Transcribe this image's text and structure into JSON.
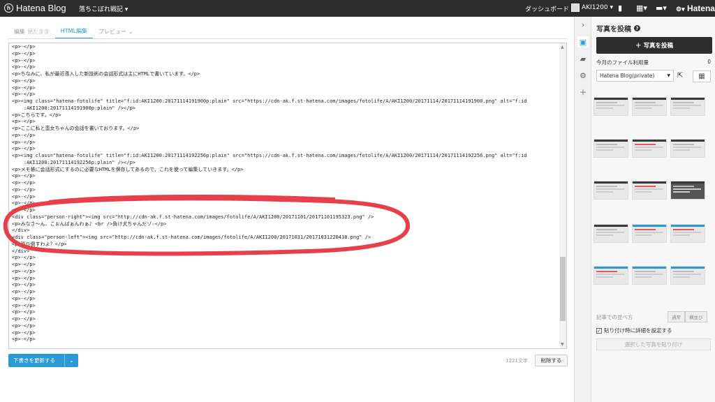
{
  "topbar": {
    "logo_text": "Hatena Blog",
    "blog_name": "落ちこぼれ戦記 ▾",
    "dashboard": "ダッシュボード",
    "user": "AKI1200 ▾",
    "brand_right": "Hatena"
  },
  "tabs": [
    {
      "label": "編集",
      "sub": "見たまま"
    },
    {
      "label": "HTML編集"
    },
    {
      "label": "プレビュー"
    }
  ],
  "code_lines": [
    "<p>-</p>",
    "<p>-</p>",
    "<p>-</p>",
    "<p>-</p>",
    "<p>ちなみに、私が最近導入した新技術の会話形式は主にHTMLで書いています。</p>",
    "<p>-</p>",
    "<p>-</p>",
    "<p>-</p>",
    "<p><img class=\"hatena-fotolife\" title=\"f:id:AKI1200:20171114191900p:plain\" src=\"https://cdn-ak.f.st-hatena.com/images/fotolife/A/AKI1200/20171114/20171114191900.png\" alt=\"f:id",
    "    :AKI1200:20171114191900p:plain\" /></p>",
    "<p>こちらです。</p>",
    "<p>-</p>",
    "<p>ここに私と蛮女ちゃんの会話を書いております。</p>",
    "<p>-</p>",
    "<p>-</p>",
    "<p>-</p>",
    "<p><img class=\"hatena-fotolife\" title=\"f:id:AKI1200:20171114192256p:plain\" src=\"https://cdn-ak.f.st-hatena.com/images/fotolife/A/AKI1200/20171114/20171114192256.png\" alt=\"f:id",
    "    :AKI1200:20171114192256p:plain\" /></p>",
    "<p>メモ帳に会話形式にするのに必要なHTMLを保存してあるので、これを使って編集していきます。</p>",
    "<p>-</p>",
    "<p>-</p>",
    "<p>-</p>",
    "<p>-</p>",
    "<p>-</p>",
    "<p>-</p>",
    "<div class=\"person-right\"><img src=\"http://cdn-ak.f.st-hatena.com/images/fotolife/A/AKI1200/20171101/20171101195323.png\" />",
    "<p>みなさ～ん、こぉんばぁんわぁ♪ <br />負け犬ちゃんだゾ☆</p>",
    "</div>",
    "<div class=\"person-left\"><img src=\"http://cdn-ak.f.st-hatena.com/images/fotolife/A/AKI1200/20171031/20171031220438.png\" />",
    "<p>張り倒すわよ？</p>",
    "</div>",
    "<p>-</p>",
    "<p>-</p>",
    "<p>-</p>",
    "<p>-</p>",
    "<p>-</p>",
    "<p>-</p>",
    "<p>-</p>",
    "<p>-</p>",
    "<p>-</p>",
    "<p>-</p>",
    "<p>-</p>",
    "<p>-</p>",
    "<p>-</p>"
  ],
  "footer": {
    "save_label": "下書きを更新する",
    "char_count": "1221文字",
    "delete_label": "削除する"
  },
  "sidebar": {
    "title": "写真を投稿",
    "post_button": "＋ 写真を投稿",
    "usage_label": "今月のファイル利用量",
    "usage_value": "0",
    "account": "Hatena Blog(private)",
    "sort_label": "記事での並べ方",
    "sort_options": [
      "通常",
      "横並び"
    ],
    "checkbox_label": "貼り付け時に詳細を設定する",
    "paste_button": "選択した写真を貼り付け"
  },
  "colors": {
    "accent": "#2a9ad4",
    "annotation": "#e8404a",
    "topbar": "#2d2d2d"
  }
}
